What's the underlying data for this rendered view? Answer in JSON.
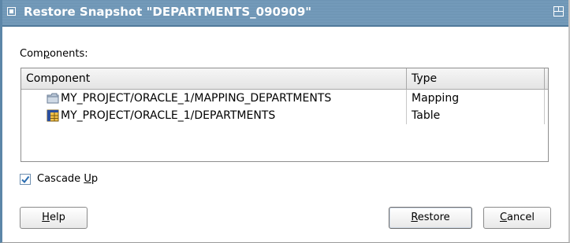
{
  "window": {
    "title": "Restore Snapshot \"DEPARTMENTS_090909\""
  },
  "components_label": {
    "before": "Com",
    "mnemonic": "p",
    "after": "onents:"
  },
  "table": {
    "columns": [
      "Component",
      "Type"
    ],
    "rows": [
      {
        "icon": "folder-mapping-icon",
        "component": "MY_PROJECT/ORACLE_1/MAPPING_DEPARTMENTS",
        "type": "Mapping"
      },
      {
        "icon": "table-icon",
        "component": "MY_PROJECT/ORACLE_1/DEPARTMENTS",
        "type": "Table"
      }
    ]
  },
  "cascade": {
    "checked": true,
    "before": "Cascade ",
    "mnemonic": "U",
    "after": "p"
  },
  "buttons": {
    "help": {
      "mnemonic": "H",
      "after": "elp"
    },
    "restore": {
      "mnemonic": "R",
      "after": "estore"
    },
    "cancel": {
      "mnemonic": "C",
      "after": "ancel"
    }
  },
  "colors": {
    "titlebar": "#6f98b9",
    "accent_border": "#5c86a8",
    "check": "#2a6cb0"
  }
}
